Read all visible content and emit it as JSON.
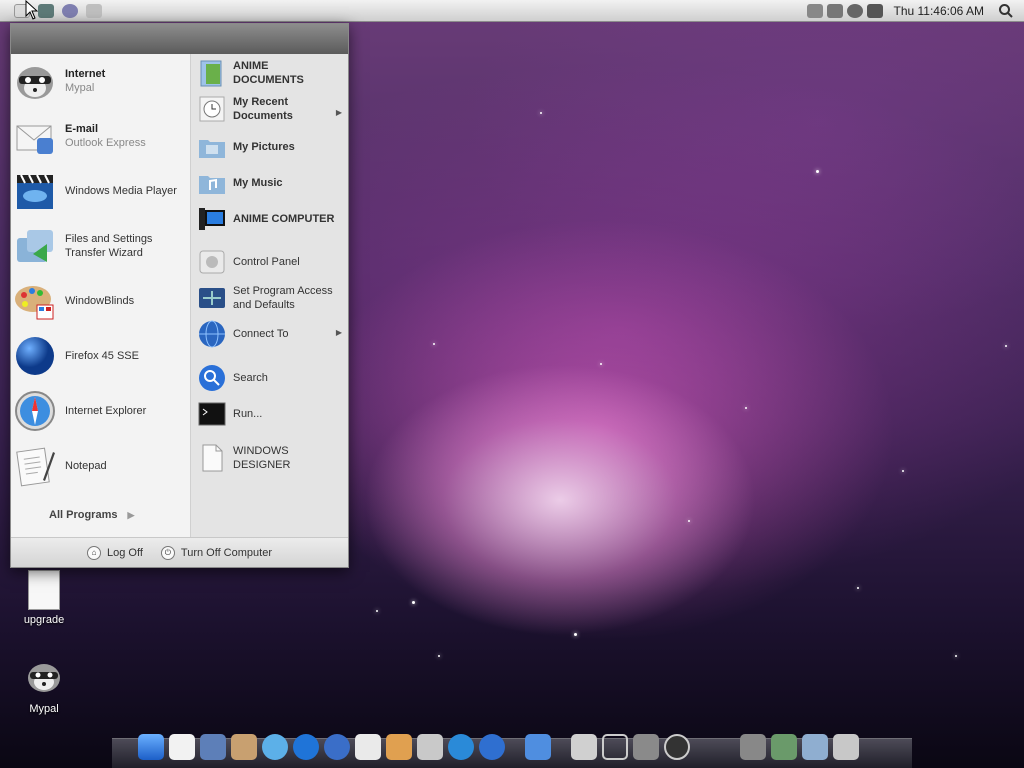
{
  "menubar": {
    "clock": "Thu 11:46:06 AM"
  },
  "startmenu": {
    "pinned": [
      {
        "title": "Internet",
        "subtitle": "Mypal",
        "icon": "raccoon-icon"
      },
      {
        "title": "E-mail",
        "subtitle": "Outlook Express",
        "icon": "mail-icon"
      },
      {
        "title": "Windows Media Player",
        "subtitle": "",
        "icon": "clapperboard-icon"
      },
      {
        "title": "Files and Settings Transfer Wizard",
        "subtitle": "",
        "icon": "transfer-icon"
      },
      {
        "title": "WindowBlinds",
        "subtitle": "",
        "icon": "palette-icon"
      },
      {
        "title": "Firefox 45 SSE",
        "subtitle": "",
        "icon": "globe-icon"
      },
      {
        "title": "Internet Explorer",
        "subtitle": "",
        "icon": "compass-icon"
      },
      {
        "title": "Notepad",
        "subtitle": "",
        "icon": "notepad-icon"
      }
    ],
    "all_programs": "All Programs",
    "places": [
      {
        "label": "ANIME DOCUMENTS",
        "bold": true,
        "submenu": false
      },
      {
        "label": "My Recent Documents",
        "bold": true,
        "submenu": true
      },
      {
        "label": "My Pictures",
        "bold": true,
        "submenu": false
      },
      {
        "label": "My Music",
        "bold": true,
        "submenu": false
      },
      {
        "label": "ANIME COMPUTER",
        "bold": true,
        "submenu": false
      },
      {
        "label": "Control Panel",
        "bold": false,
        "submenu": false
      },
      {
        "label": "Set Program Access and Defaults",
        "bold": false,
        "submenu": false
      },
      {
        "label": "Connect To",
        "bold": false,
        "submenu": true
      },
      {
        "label": "Search",
        "bold": false,
        "submenu": false
      },
      {
        "label": "Run...",
        "bold": false,
        "submenu": false
      },
      {
        "label": "WINDOWS DESIGNER",
        "bold": false,
        "submenu": false
      }
    ],
    "log_off": "Log Off",
    "turn_off": "Turn Off Computer"
  },
  "desktop": {
    "icons": [
      {
        "label": "upgrade",
        "icon": "document-icon"
      },
      {
        "label": "Mypal",
        "icon": "raccoon-icon"
      }
    ]
  },
  "colors": {
    "accent_blue": "#2f6fd0",
    "menu_bg": "#e9e9e9"
  }
}
